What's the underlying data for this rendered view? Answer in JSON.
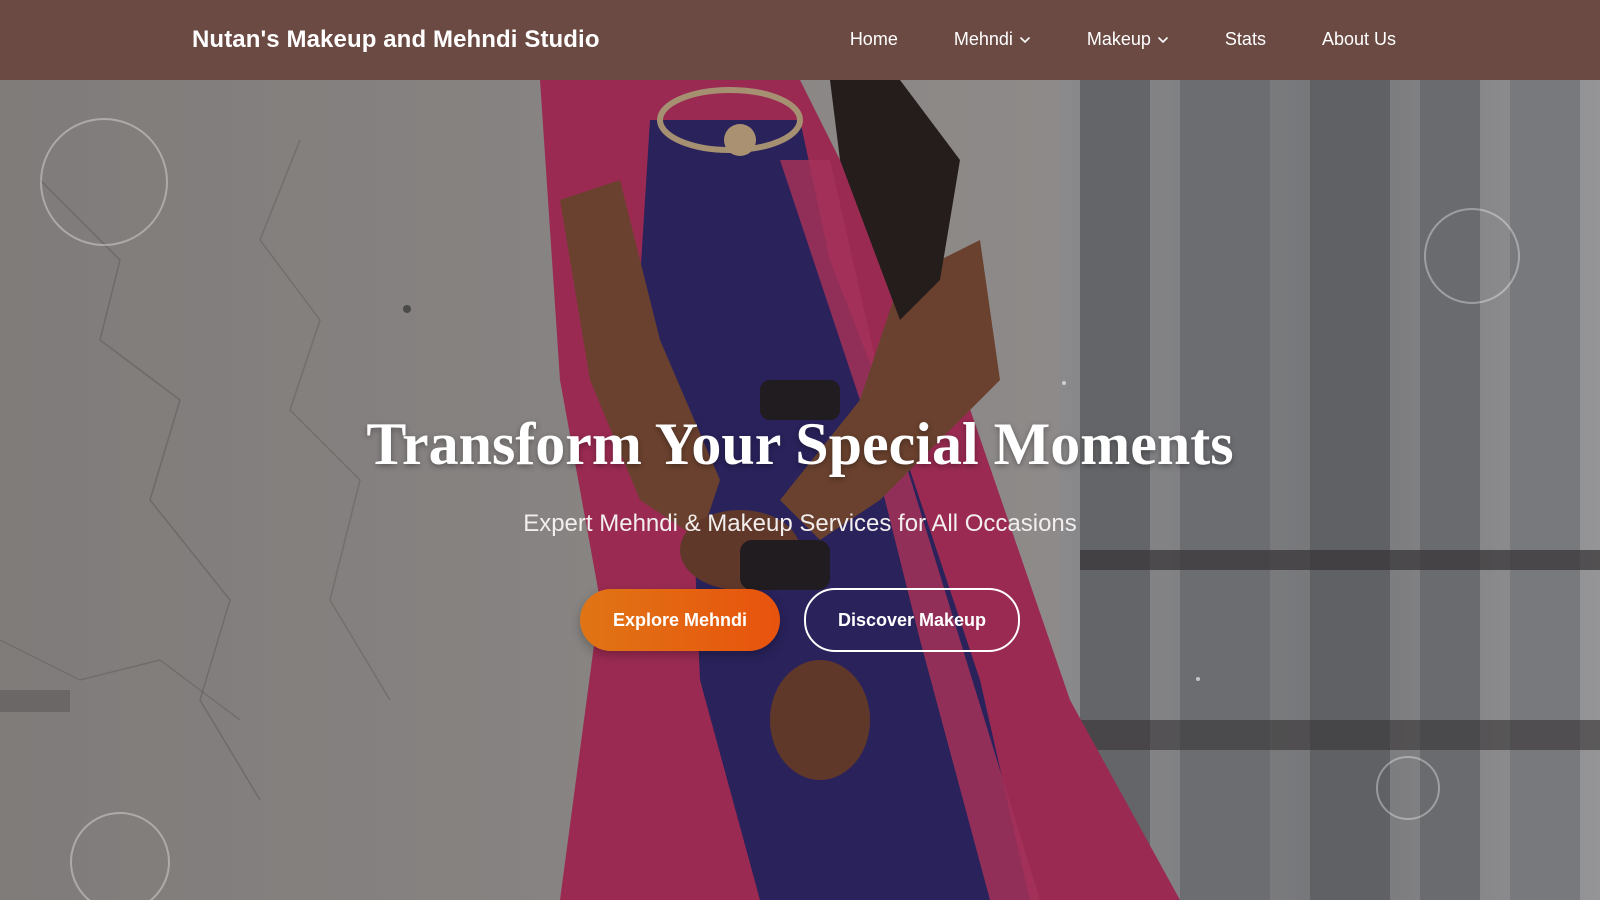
{
  "brand": {
    "name": "Nutan's Makeup and Mehndi Studio"
  },
  "nav": {
    "items": [
      {
        "label": "Home",
        "has_dropdown": false
      },
      {
        "label": "Mehndi",
        "has_dropdown": true
      },
      {
        "label": "Makeup",
        "has_dropdown": true
      },
      {
        "label": "Stats",
        "has_dropdown": false
      },
      {
        "label": "About Us",
        "has_dropdown": false
      }
    ],
    "dropdown_icon": "chevron-down-icon"
  },
  "hero": {
    "title": "Transform Your Special Moments",
    "subtitle": "Expert Mehndi & Makeup Services for All Occasions",
    "primary_button": "Explore Mehndi",
    "secondary_button": "Discover Makeup"
  },
  "colors": {
    "navbar_bg": "#6b4a43",
    "primary_gradient_start": "#e07515",
    "primary_gradient_end": "#e8530d",
    "text": "#ffffff"
  }
}
